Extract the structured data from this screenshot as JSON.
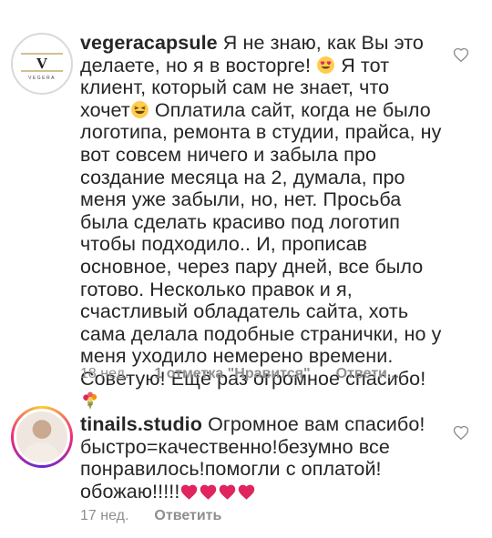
{
  "comments": [
    {
      "username": "vegeracapsule",
      "avatar_logo_letter": "V",
      "avatar_logo_text": "VEGERA",
      "text_part1": "Я не знаю, как Вы это делаете, но я в восторге!",
      "text_part2": "Я тот клиент, который сам не знает, что хочет",
      "text_part3": "Оплатила сайт, когда не было логотипа, ремонта в студии, прайса, ну вот совсем ничего и забыла про создание месяца на 2, думала, про меня уже забыли, но, нет. Просьба была сделать красиво под логотип чтобы подходило.. И, прописав основное, через пару дней, все было готово. Несколько правок и я, счастливый обладатель сайта, хоть сама делала подобные странички, но у меня уходило немерено времени. Советую! Ещё раз огромное спасибо!",
      "emoji1": "heart-eyes-emoji",
      "emoji2": "laughing-emoji",
      "emoji3": "bouquet-emoji",
      "time": "18 нед.",
      "likes": "1 отметка \"Нравится\"",
      "reply": "Ответи..."
    },
    {
      "username": "tinails.studio",
      "text": "Огромное вам спасибо! быстро=качественно!безумно все понравилось!помогли с оплатой! обожаю!!!!!",
      "hearts_emoji": "red-heart-emoji",
      "hearts_count": 4,
      "time": "17 нед.",
      "reply": "Ответить"
    }
  ],
  "colors": {
    "text": "#262626",
    "muted": "#8e8e8e",
    "heart": "#e0245e"
  }
}
